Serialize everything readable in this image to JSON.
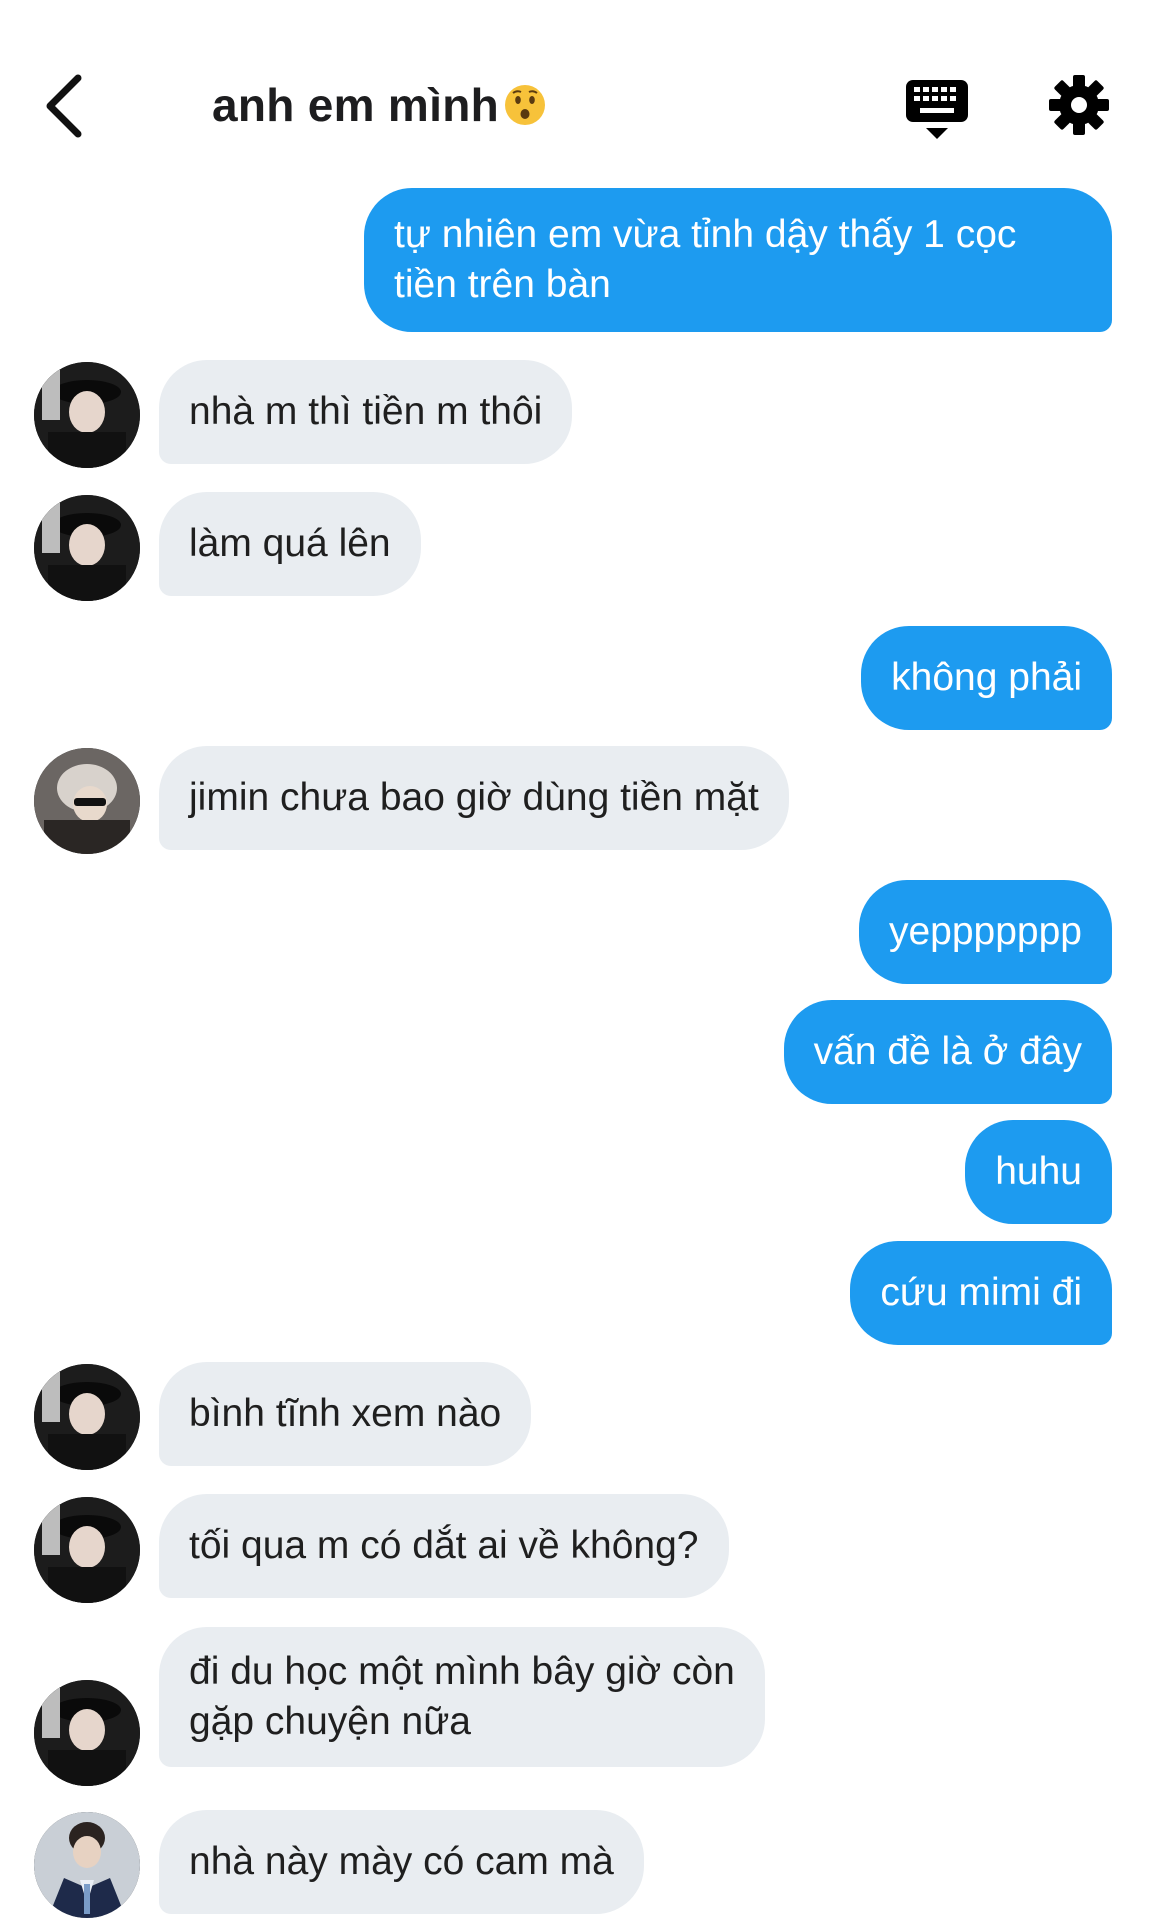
{
  "header": {
    "title": "anh em mình",
    "emoji_icon": "hushed-face-emoji-icon",
    "back_icon": "chevron-left-icon",
    "keyboard_icon": "keyboard-icon",
    "settings_icon": "gear-icon"
  },
  "colors": {
    "outgoing_bubble": "#1d9bf0",
    "incoming_bubble": "#e9edf1",
    "title_text": "#1d1d1f"
  },
  "messages": [
    {
      "from": "me",
      "text": "tự nhiên em vừa tỉnh dậy thấy 1 cọc\ntiền trên bàn"
    },
    {
      "from": "member",
      "avatar": "avatar-dark-hat",
      "text": "nhà m thì tiền m thôi"
    },
    {
      "from": "member",
      "avatar": "avatar-dark-hat",
      "text": "làm quá lên"
    },
    {
      "from": "me",
      "text": "không phải"
    },
    {
      "from": "member",
      "avatar": "avatar-silver-hair",
      "text": "jimin chưa bao giờ dùng tiền mặt"
    },
    {
      "from": "me",
      "text": "yeppppppp"
    },
    {
      "from": "me",
      "text": "vấn đề là ở đây"
    },
    {
      "from": "me",
      "text": "huhu"
    },
    {
      "from": "me",
      "text": "cứu mimi đi"
    },
    {
      "from": "member",
      "avatar": "avatar-dark-hat",
      "text": "bình tĩnh xem nào"
    },
    {
      "from": "member",
      "avatar": "avatar-dark-hat",
      "text": "tối qua m có dắt ai về không?"
    },
    {
      "from": "member",
      "avatar": "avatar-dark-hat",
      "text": "đi du học một mình bây giờ còn\ngặp chuyện nữa"
    },
    {
      "from": "member",
      "avatar": "avatar-suit",
      "text": "nhà này mày có cam mà"
    }
  ]
}
